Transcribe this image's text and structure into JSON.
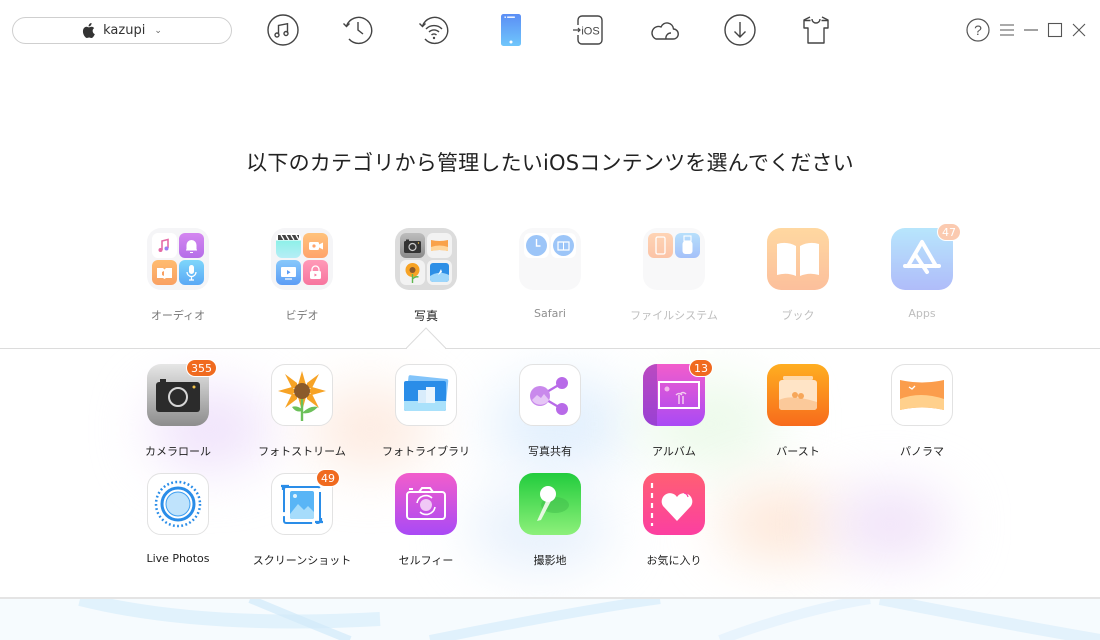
{
  "device": {
    "name": "kazupi",
    "icon": "apple-icon"
  },
  "toolbar": [
    {
      "id": "music",
      "icon": "music-note-icon",
      "active": false
    },
    {
      "id": "backup",
      "icon": "history-icon",
      "active": false
    },
    {
      "id": "wifi-sync",
      "icon": "wifi-backup-icon",
      "active": false
    },
    {
      "id": "device",
      "icon": "iphone-icon",
      "active": true
    },
    {
      "id": "ios-mover",
      "icon": "to-ios-icon",
      "active": false,
      "text": "iOS"
    },
    {
      "id": "icloud",
      "icon": "cloud-icon",
      "active": false
    },
    {
      "id": "download",
      "icon": "download-icon",
      "active": false
    },
    {
      "id": "toolkit",
      "icon": "tshirt-icon",
      "active": false
    }
  ],
  "window_controls": [
    "help-icon",
    "menu-icon",
    "minimize-icon",
    "maximize-icon",
    "close-icon"
  ],
  "heading": "以下のカテゴリから管理したいiOSコンテンツを選んでください",
  "categories": [
    {
      "label": "オーディオ",
      "active": false
    },
    {
      "label": "ビデオ",
      "active": false
    },
    {
      "label": "写真",
      "active": true
    },
    {
      "label": "Safari",
      "active": false
    },
    {
      "label": "ファイルシステム",
      "active": false
    },
    {
      "label": "ブック",
      "active": false
    },
    {
      "label": "Apps",
      "active": false,
      "badge": "47"
    }
  ],
  "photo_items": [
    {
      "label": "カメラロール",
      "badge": "355"
    },
    {
      "label": "フォトストリーム"
    },
    {
      "label": "フォトライブラリ"
    },
    {
      "label": "写真共有"
    },
    {
      "label": "アルバム",
      "badge": "13"
    },
    {
      "label": "バースト"
    },
    {
      "label": "パノラマ"
    },
    {
      "label": "Live Photos"
    },
    {
      "label": "スクリーンショット",
      "badge": "49"
    },
    {
      "label": "セルフィー"
    },
    {
      "label": "撮影地"
    },
    {
      "label": "お気に入り"
    }
  ],
  "colors": {
    "accent_blue": "#5b9cf5",
    "badge_orange": "#f06a1f",
    "divider": "#dcdcdc"
  }
}
